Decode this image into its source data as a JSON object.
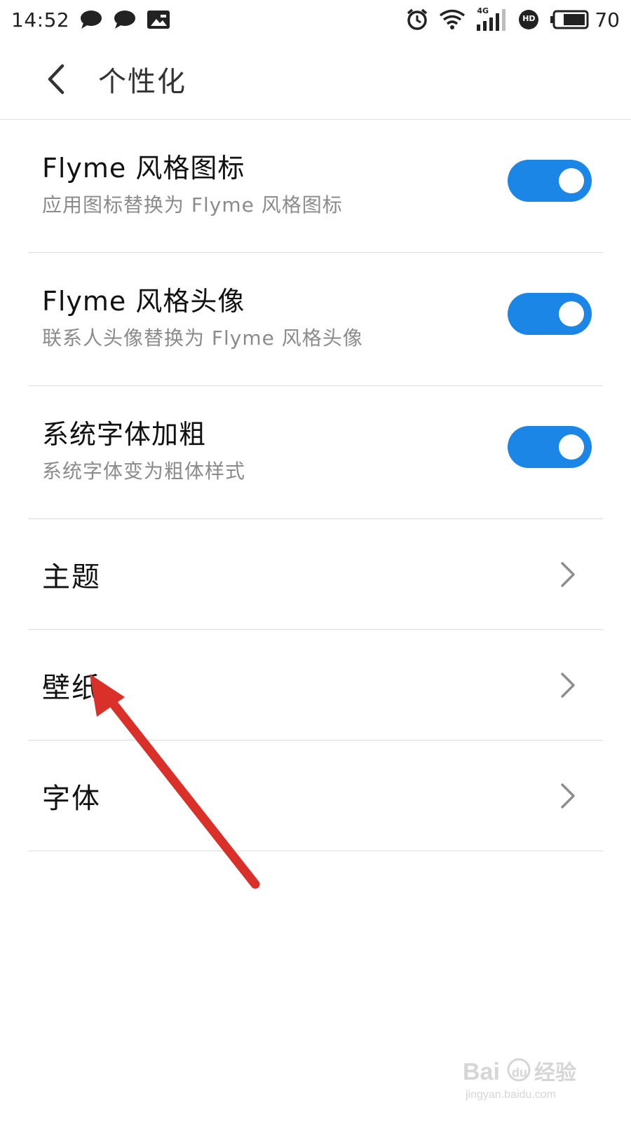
{
  "status_bar": {
    "time": "14:52",
    "left_icons": [
      "chat-bubble-icon",
      "chat-bubble-icon",
      "image-notification-icon"
    ],
    "right_icons": [
      "alarm-icon",
      "wifi-icon",
      "signal-4g-icon",
      "hd-icon",
      "battery-icon"
    ],
    "network_label": "4G",
    "hd_label": "HD",
    "battery_level": "70"
  },
  "header": {
    "title": "个性化",
    "back_icon": "chevron-left-icon"
  },
  "toggle_items": [
    {
      "title": "Flyme 风格图标",
      "subtitle": "应用图标替换为 Flyme 风格图标",
      "enabled": true
    },
    {
      "title": "Flyme 风格头像",
      "subtitle": "联系人头像替换为 Flyme 风格头像",
      "enabled": true
    },
    {
      "title": "系统字体加粗",
      "subtitle": "系统字体变为粗体样式",
      "enabled": true
    }
  ],
  "nav_items": [
    {
      "label": "主题",
      "icon": "chevron-right-icon"
    },
    {
      "label": "壁纸",
      "icon": "chevron-right-icon"
    },
    {
      "label": "字体",
      "icon": "chevron-right-icon"
    }
  ],
  "annotation": {
    "type": "arrow",
    "color": "#d9302a",
    "target": "壁纸"
  },
  "watermark": {
    "brand": "Baidu经验",
    "url": "jingyan.baidu.com"
  },
  "colors": {
    "accent": "#1c86e6",
    "subtitle": "#8b8b8b",
    "divider": "#dcdcdc"
  }
}
